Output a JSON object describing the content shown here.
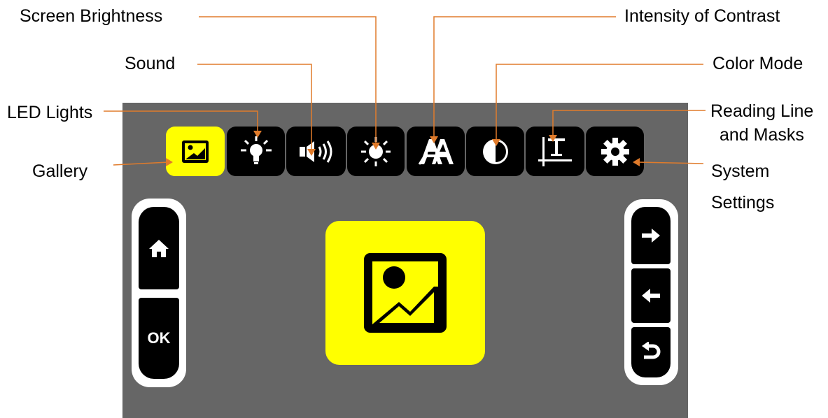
{
  "labels": {
    "screen_brightness": "Screen Brightness",
    "sound": "Sound",
    "led_lights": "LED Lights",
    "gallery": "Gallery",
    "intensity_of_contrast": "Intensity of Contrast",
    "color_mode": "Color Mode",
    "reading_line_1": "Reading Line",
    "reading_line_2": "and Masks",
    "system_1": "System",
    "system_2": "Settings"
  },
  "toolbar": {
    "items": [
      {
        "icon": "gallery-icon",
        "active": true
      },
      {
        "icon": "led-bulb-icon",
        "active": false
      },
      {
        "icon": "speaker-icon",
        "active": false
      },
      {
        "icon": "sun-icon",
        "active": false
      },
      {
        "icon": "contrast-text-icon",
        "active": false
      },
      {
        "icon": "half-circle-icon",
        "active": false
      },
      {
        "icon": "reading-line-icon",
        "active": false
      },
      {
        "icon": "gear-icon",
        "active": false
      }
    ]
  },
  "left_buttons": {
    "home_icon": "home-icon",
    "ok_label": "OK"
  },
  "right_buttons": {
    "icons": [
      "arrow-right-icon",
      "arrow-left-icon",
      "return-icon"
    ]
  },
  "colors": {
    "screen": "#666666",
    "accent": "#ffff00",
    "button": "#000000",
    "leader": "#e07b2b"
  }
}
